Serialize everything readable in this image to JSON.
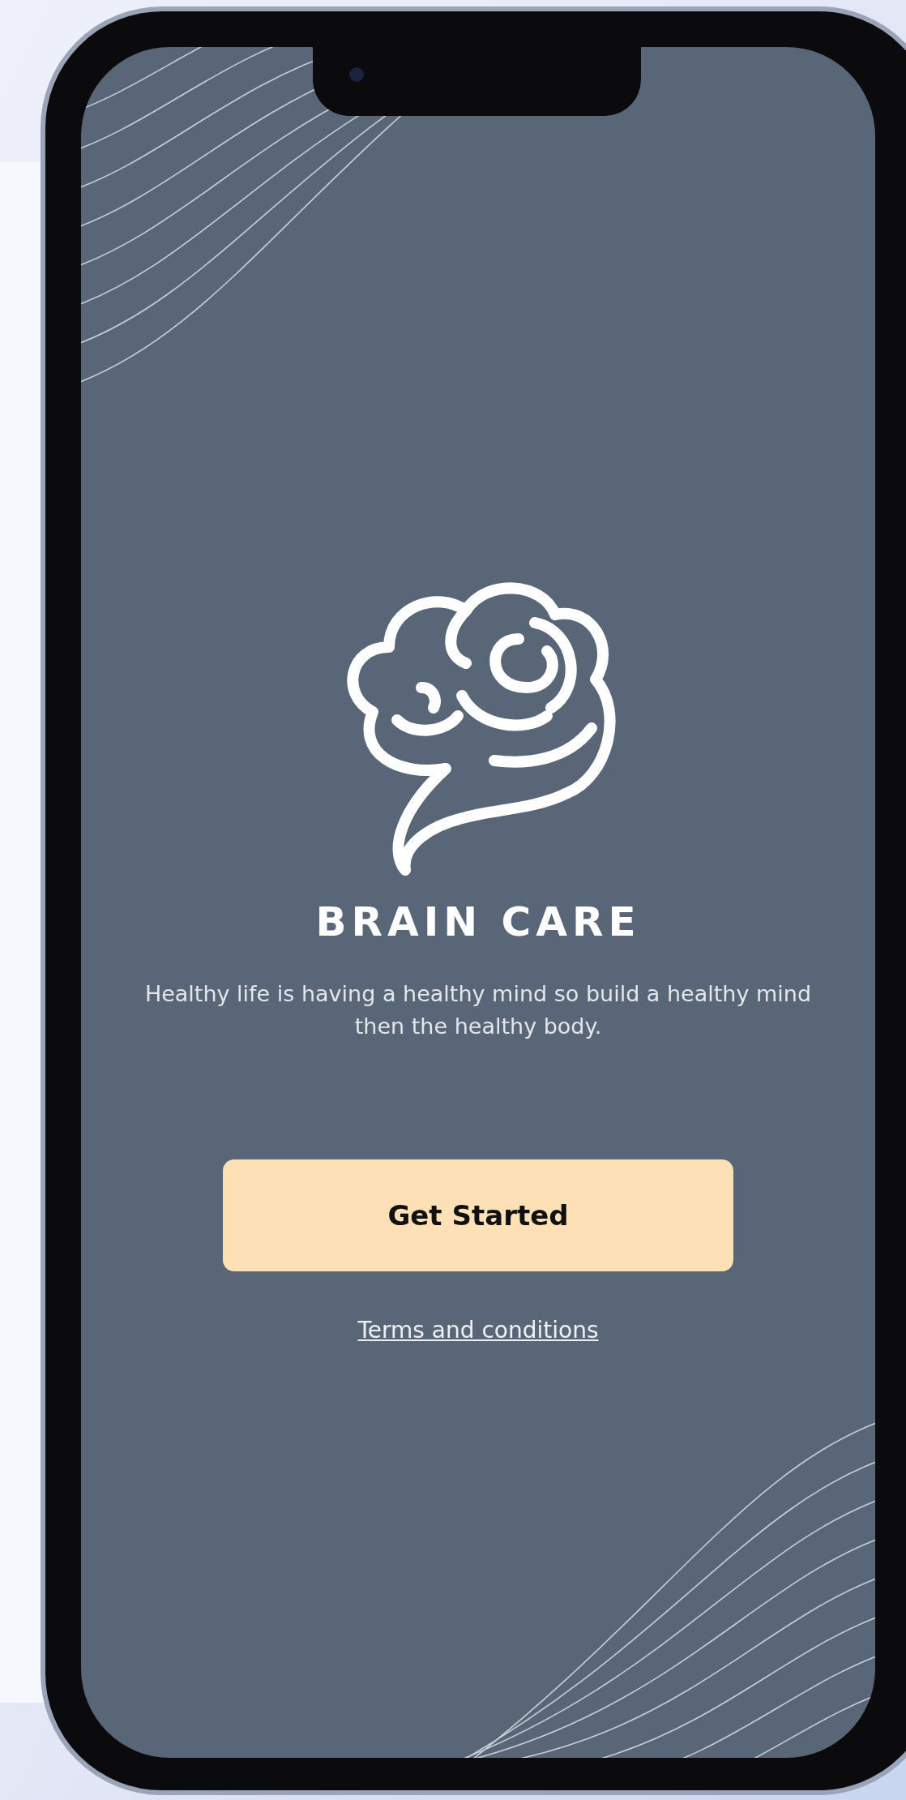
{
  "app": {
    "title": "BRAIN CARE",
    "tagline": "Healthy life is having a healthy mind so build a healthy mind then the healthy body."
  },
  "primary_button": {
    "label": "Get Started"
  },
  "link": {
    "label": "Terms and conditions"
  }
}
